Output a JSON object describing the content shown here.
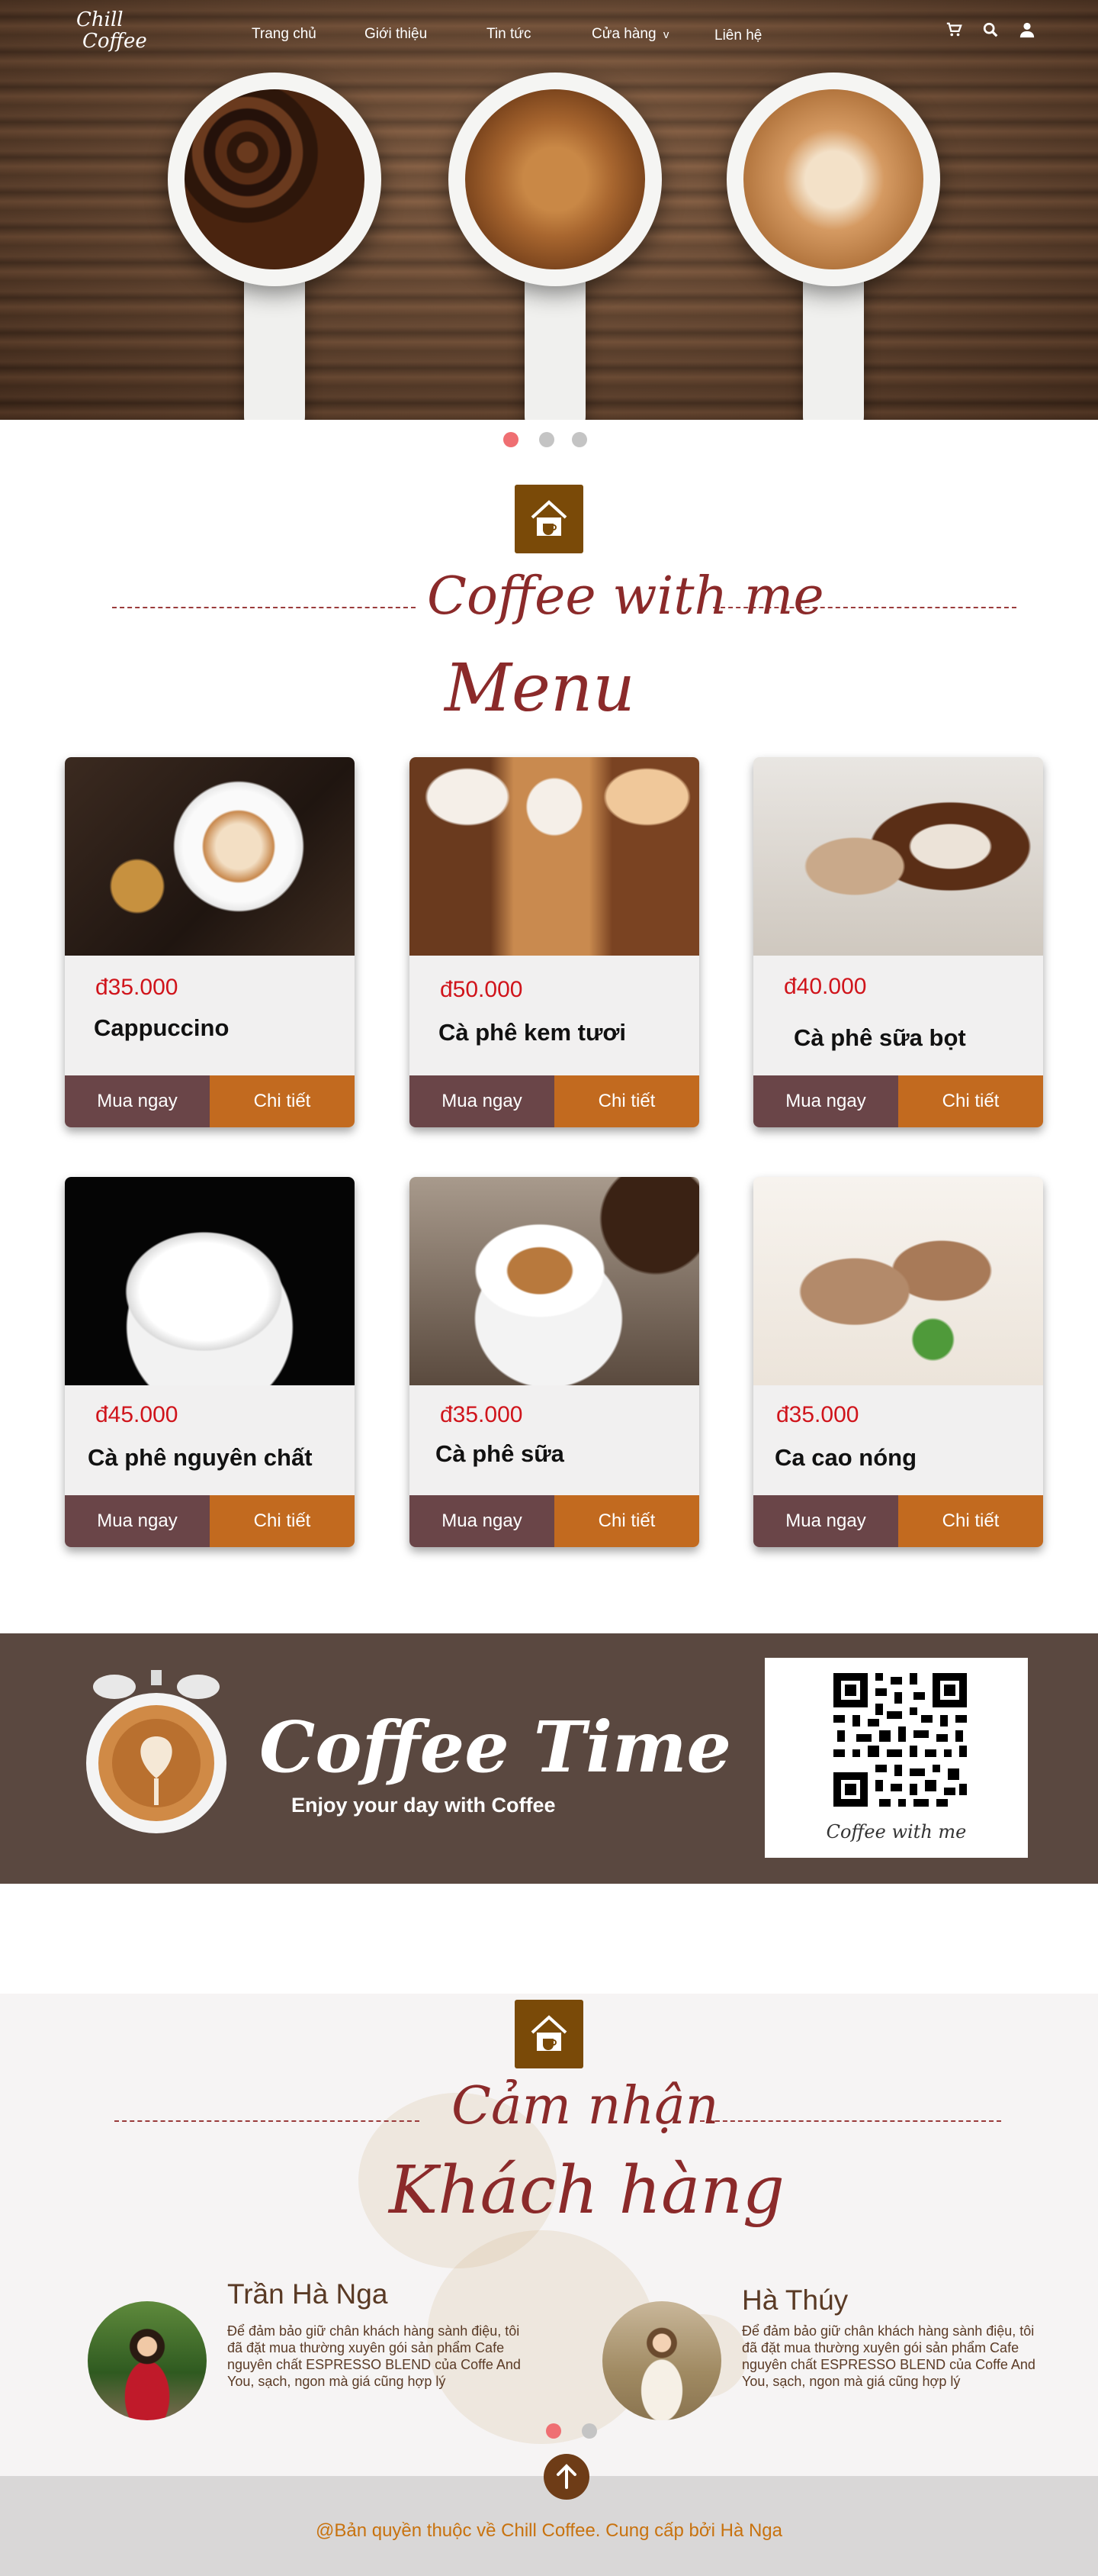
{
  "nav": {
    "logo_line1": "Chill",
    "logo_line2": "Coffee",
    "items": [
      "Trang chủ",
      "Giới thiệu",
      "Tin tức",
      "Cửa hàng",
      "Liên hệ"
    ],
    "dropdown_marker": "v",
    "icons": [
      "cart-icon",
      "search-icon",
      "user-icon"
    ]
  },
  "hero": {
    "slide_count": 3,
    "active_slide": 1
  },
  "menu_section": {
    "heading_script": "Coffee with me",
    "heading_big": "Menu"
  },
  "products": [
    {
      "price": "đ35.000",
      "name": "Cappuccino",
      "buy": "Mua ngay",
      "detail": "Chi tiết"
    },
    {
      "price": "đ50.000",
      "name": "Cà phê kem tươi",
      "buy": "Mua ngay",
      "detail": "Chi tiết"
    },
    {
      "price": "đ40.000",
      "name": "Cà phê sữa bọt",
      "buy": "Mua ngay",
      "detail": "Chi tiết"
    },
    {
      "price": "đ45.000",
      "name": "Cà phê nguyên chất",
      "buy": "Mua ngay",
      "detail": "Chi tiết"
    },
    {
      "price": "đ35.000",
      "name": "Cà phê sữa",
      "buy": "Mua ngay",
      "detail": "Chi tiết"
    },
    {
      "price": "đ35.000",
      "name": "Ca cao nóng",
      "buy": "Mua ngay",
      "detail": "Chi tiết"
    }
  ],
  "banner": {
    "title": "Coffee Time",
    "subtitle": "Enjoy your day with Coffee",
    "qr_caption": "Coffee with me"
  },
  "testimonials_section": {
    "heading_script": "Cảm nhận",
    "heading_big": "Khách hàng",
    "items": [
      {
        "name": "Trần Hà Nga",
        "text": "Để đảm bảo giữ chân khách hàng sành điệu, tôi đã đặt mua thường xuyên gói sản phẩm Cafe nguyên chất ESPRESSO BLEND của Coffe And You, sạch, ngon mà giá cũng hợp lý"
      },
      {
        "name": "Hà Thúy",
        "text": "Để đảm bảo giữ chân khách hàng sành điệu, tôi đã đặt mua thường xuyên gói sản phẩm Cafe nguyên chất ESPRESSO BLEND của Coffe And You, sạch, ngon mà giá cũng hợp lý"
      }
    ]
  },
  "footer": {
    "text": "@Bản quyền thuộc về Chill Coffee. Cung cấp bởi Hà Nga"
  },
  "colors": {
    "accent_red": "#d0141b",
    "script_red": "#8b2a2a",
    "buy_button": "#6a4548",
    "detail_button": "#c26a1f",
    "badge_brown": "#7a4a08",
    "banner_bg": "#5a4840",
    "footer_text": "#c8720e"
  }
}
